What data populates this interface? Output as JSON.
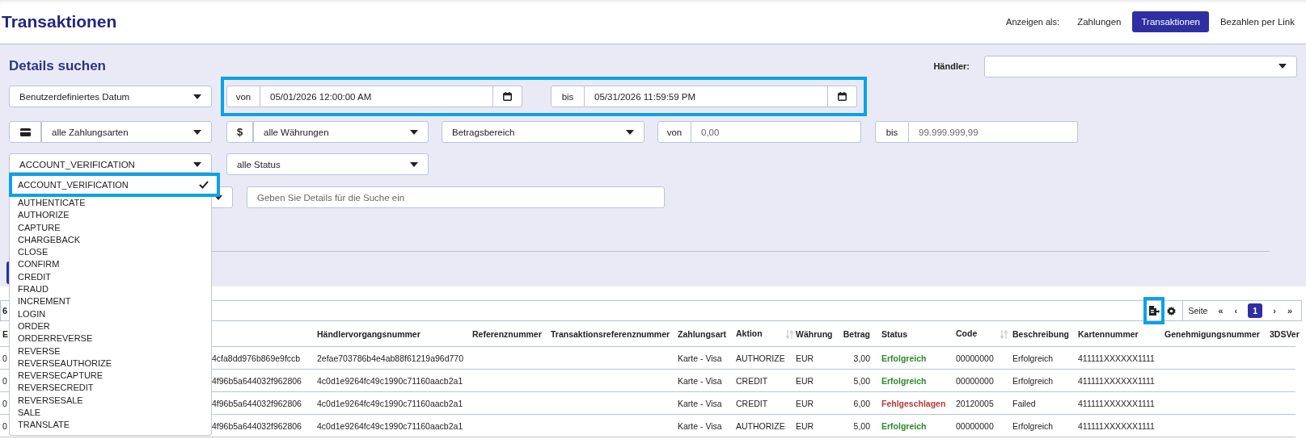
{
  "header": {
    "title": "Transaktionen",
    "view_label": "Anzeigen als:",
    "view_tabs": [
      {
        "label": "Zahlungen",
        "selected": false
      },
      {
        "label": "Transaktionen",
        "selected": true
      },
      {
        "label": "Bezahlen per Link",
        "selected": false
      }
    ]
  },
  "filters": {
    "title": "Details suchen",
    "merchant_label": "Händler:",
    "date_preset": "Benutzerdefiniertes Datum",
    "date_from": {
      "label": "von",
      "value": "05/01/2026 12:00:00 AM"
    },
    "date_to": {
      "label": "bis",
      "value": "05/31/2026 11:59:59 PM"
    },
    "payment_type": "alle Zahlungsarten",
    "currency_symbol": "$",
    "currency": "alle Währungen",
    "amount_range": "Betragsbereich",
    "amount_from": {
      "label": "von",
      "placeholder": "0,00"
    },
    "amount_to": {
      "label": "bis",
      "placeholder": "99.999.999,99"
    },
    "action": "ACCOUNT_VERIFICATION",
    "status": "alle Status",
    "search": {
      "placeholder": "Geben Sie Details für die Suche ein"
    }
  },
  "action_dropdown": {
    "options": [
      {
        "label": "ACCOUNT_VERIFICATION",
        "selected": true
      },
      {
        "label": "AUTHENTICATE",
        "selected": false
      },
      {
        "label": "AUTHORIZE",
        "selected": false
      },
      {
        "label": "CAPTURE",
        "selected": false
      },
      {
        "label": "CHARGEBACK",
        "selected": false
      },
      {
        "label": "CLOSE",
        "selected": false
      },
      {
        "label": "CONFIRM",
        "selected": false
      },
      {
        "label": "CREDIT",
        "selected": false
      },
      {
        "label": "FRAUD",
        "selected": false
      },
      {
        "label": "INCREMENT",
        "selected": false
      },
      {
        "label": "LOGIN",
        "selected": false
      },
      {
        "label": "ORDER",
        "selected": false
      },
      {
        "label": "ORDERREVERSE",
        "selected": false
      },
      {
        "label": "REVERSE",
        "selected": false
      },
      {
        "label": "REVERSEAUTHORIZE",
        "selected": false
      },
      {
        "label": "REVERSECAPTURE",
        "selected": false
      },
      {
        "label": "REVERSECREDIT",
        "selected": false
      },
      {
        "label": "REVERSESALE",
        "selected": false
      },
      {
        "label": "SALE",
        "selected": false
      },
      {
        "label": "TRANSLATE",
        "selected": false
      }
    ]
  },
  "results": {
    "count": "6",
    "page_label": "Seite",
    "pager": [
      {
        "label": "«",
        "kind": "nav",
        "selected": false
      },
      {
        "label": "‹",
        "kind": "nav",
        "selected": false
      },
      {
        "label": "1",
        "kind": "page",
        "selected": true
      },
      {
        "label": "›",
        "kind": "nav",
        "selected": false
      },
      {
        "label": "»",
        "kind": "nav",
        "selected": false
      }
    ]
  },
  "table": {
    "columns": [
      {
        "label": "E",
        "sortable": false
      },
      {
        "label": "Händlervorgangsnummer",
        "sortable": false
      },
      {
        "label": "Referenznummer",
        "sortable": false
      },
      {
        "label": "Transaktionsreferenznummer",
        "sortable": false
      },
      {
        "label": "Zahlungsart",
        "sortable": false
      },
      {
        "label": "Aktion",
        "sortable": true
      },
      {
        "label": "Währung",
        "sortable": false
      },
      {
        "label": "Betrag",
        "sortable": false
      },
      {
        "label": "Status",
        "sortable": false
      },
      {
        "label": "Code",
        "sortable": true
      },
      {
        "label": "Beschreibung",
        "sortable": false
      },
      {
        "label": "Kartennummer",
        "sortable": false
      },
      {
        "label": "Genehmigungsnummer",
        "sortable": false
      },
      {
        "label": "3DSVer",
        "sortable": false
      }
    ],
    "rows": [
      {
        "column_1": "0",
        "column_2": "4cfa8dd976b869e9fccb",
        "merchant_ref": "2efae703786b4e4ab88f61219a96d770",
        "payment_type": "Karte - Visa",
        "action": "AUTHORIZE",
        "currency": "EUR",
        "amount": "3,00",
        "status": "Erfolgreich",
        "color": "#2a8a2a",
        "code": "00000000",
        "description": "Erfolgreich",
        "card_number": "411111XXXXXX1111"
      },
      {
        "column_1": "0",
        "column_2": "4f96b5a644032f962806",
        "merchant_ref": "4c0d1e9264fc49c1990c71160aacb2a1",
        "payment_type": "Karte - Visa",
        "action": "CREDIT",
        "currency": "EUR",
        "amount": "5,00",
        "status": "Erfolgreich",
        "color": "#2a8a2a",
        "code": "00000000",
        "description": "Erfolgreich",
        "card_number": "411111XXXXXX1111"
      },
      {
        "column_1": "0",
        "column_2": "4f96b5a644032f962806",
        "merchant_ref": "4c0d1e9264fc49c1990c71160aacb2a1",
        "payment_type": "Karte - Visa",
        "action": "CREDIT",
        "currency": "EUR",
        "amount": "6,00",
        "status": "Fehlgeschlagen",
        "color": "#b53a3a",
        "code": "20120005",
        "description": "Failed",
        "card_number": "411111XXXXXX1111"
      },
      {
        "column_1": "0",
        "column_2": "4f96b5a644032f962806",
        "merchant_ref": "4c0d1e9264fc49c1990c71160aacb2a1",
        "payment_type": "Karte - Visa",
        "action": "AUTHORIZE",
        "currency": "EUR",
        "amount": "5,00",
        "status": "Erfolgreich",
        "color": "#2a8a2a",
        "code": "00000000",
        "description": "Erfolgreich",
        "card_number": "411111XXXXXX1111"
      }
    ]
  }
}
